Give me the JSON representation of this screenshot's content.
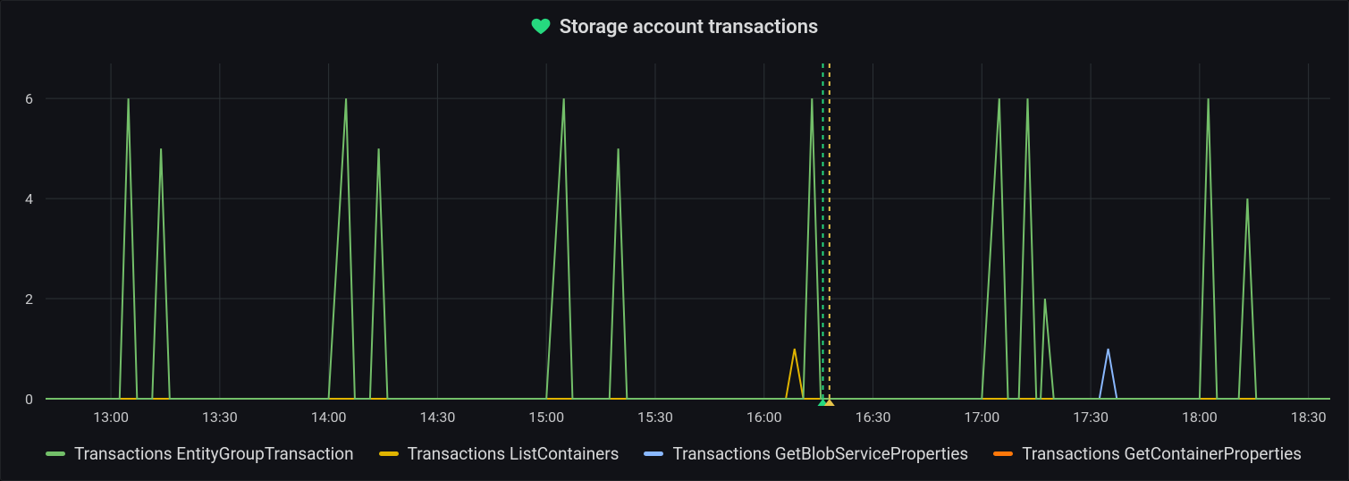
{
  "panel": {
    "title": "Storage account transactions",
    "icon": "heart-icon",
    "icon_color": "#26d97f"
  },
  "legend": [
    {
      "label": "Transactions EntityGroupTransaction",
      "color": "#73bf69"
    },
    {
      "label": "Transactions ListContainers",
      "color": "#e0b400"
    },
    {
      "label": "Transactions GetBlobServiceProperties",
      "color": "#8ab8ff"
    },
    {
      "label": "Transactions GetContainerProperties",
      "color": "#ff780a"
    }
  ],
  "annotations": {
    "markers": [
      {
        "x": 16.27,
        "color": "#26d97f"
      },
      {
        "x": 16.3,
        "color": "#e6c34a"
      }
    ]
  },
  "chart_data": {
    "type": "line",
    "title": "Storage account transactions",
    "xlabel": "",
    "ylabel": "",
    "ylim": [
      0,
      6.7
    ],
    "xlim": [
      12.7,
      18.6
    ],
    "y_ticks": [
      0,
      2,
      4,
      6
    ],
    "x_ticks": [
      {
        "v": 13.0,
        "label": "13:00"
      },
      {
        "v": 13.5,
        "label": "13:30"
      },
      {
        "v": 14.0,
        "label": "14:00"
      },
      {
        "v": 14.5,
        "label": "14:30"
      },
      {
        "v": 15.0,
        "label": "15:00"
      },
      {
        "v": 15.5,
        "label": "15:30"
      },
      {
        "v": 16.0,
        "label": "16:00"
      },
      {
        "v": 16.5,
        "label": "16:30"
      },
      {
        "v": 17.0,
        "label": "17:00"
      },
      {
        "v": 17.5,
        "label": "17:30"
      },
      {
        "v": 18.0,
        "label": "18:00"
      },
      {
        "v": 18.5,
        "label": "18:30"
      }
    ],
    "series": [
      {
        "name": "Transactions EntityGroupTransaction",
        "color": "#73bf69",
        "points": [
          [
            12.7,
            0
          ],
          [
            13.04,
            0
          ],
          [
            13.08,
            6
          ],
          [
            13.12,
            0
          ],
          [
            13.19,
            0
          ],
          [
            13.23,
            5
          ],
          [
            13.27,
            0
          ],
          [
            13.96,
            0
          ],
          [
            14.0,
            0
          ],
          [
            14.08,
            6
          ],
          [
            14.12,
            0
          ],
          [
            14.19,
            0
          ],
          [
            14.23,
            5
          ],
          [
            14.27,
            0
          ],
          [
            15.0,
            0
          ],
          [
            15.08,
            6
          ],
          [
            15.12,
            0
          ],
          [
            15.29,
            0
          ],
          [
            15.33,
            5
          ],
          [
            15.37,
            0
          ],
          [
            16.0,
            0
          ],
          [
            16.18,
            0
          ],
          [
            16.22,
            6
          ],
          [
            16.26,
            0
          ],
          [
            16.9,
            0
          ],
          [
            17.0,
            0
          ],
          [
            17.08,
            6
          ],
          [
            17.12,
            0
          ],
          [
            17.17,
            0
          ],
          [
            17.21,
            6
          ],
          [
            17.25,
            0
          ],
          [
            17.27,
            0
          ],
          [
            17.29,
            2
          ],
          [
            17.33,
            0
          ],
          [
            17.9,
            0
          ],
          [
            18.0,
            0
          ],
          [
            18.04,
            6
          ],
          [
            18.08,
            0
          ],
          [
            18.18,
            0
          ],
          [
            18.22,
            4
          ],
          [
            18.26,
            0
          ],
          [
            18.6,
            0
          ]
        ]
      },
      {
        "name": "Transactions ListContainers",
        "color": "#e0b400",
        "points": [
          [
            12.7,
            0
          ],
          [
            16.1,
            0
          ],
          [
            16.14,
            1
          ],
          [
            16.18,
            0
          ],
          [
            18.6,
            0
          ]
        ]
      },
      {
        "name": "Transactions GetBlobServiceProperties",
        "color": "#8ab8ff",
        "points": [
          [
            12.7,
            0
          ],
          [
            17.54,
            0
          ],
          [
            17.58,
            1
          ],
          [
            17.62,
            0
          ],
          [
            18.6,
            0
          ]
        ]
      },
      {
        "name": "Transactions GetContainerProperties",
        "color": "#ff780a",
        "points": [
          [
            12.7,
            0
          ],
          [
            18.6,
            0
          ]
        ]
      }
    ]
  }
}
